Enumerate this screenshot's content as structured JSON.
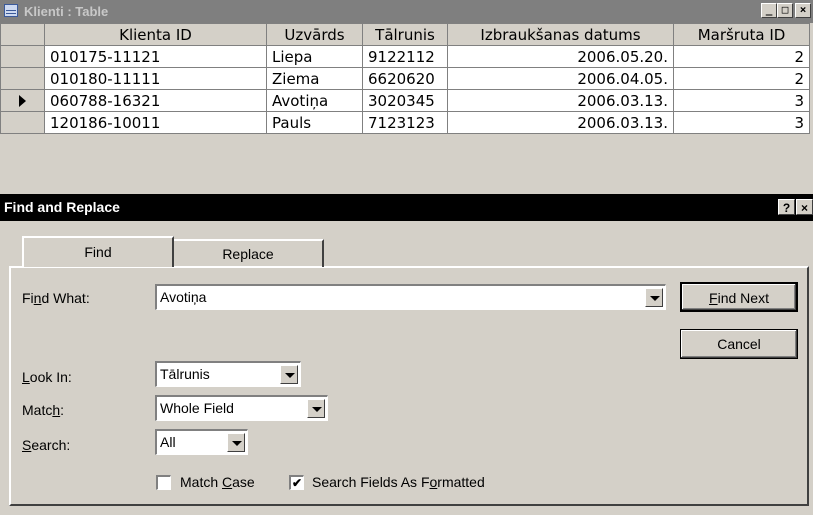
{
  "table_window": {
    "title": "Klienti : Table",
    "buttons": {
      "minimize": "_",
      "maximize": "□",
      "close": "×"
    },
    "columns": [
      "Klienta ID",
      "Uzvārds",
      "Tālrunis",
      "Izbraukšanas datums",
      "Maršruta ID"
    ],
    "rows": [
      {
        "selector": "",
        "cells": [
          "010175-11121",
          "Liepa",
          "9122112",
          "2006.05.20.",
          "2"
        ]
      },
      {
        "selector": "",
        "cells": [
          "010180-11111",
          "Ziema",
          "6620620",
          "2006.04.05.",
          "2"
        ]
      },
      {
        "selector": "current-record-arrow",
        "cells": [
          "060788-16321",
          "Avotiņa",
          "3020345",
          "2006.03.13.",
          "3"
        ]
      },
      {
        "selector": "",
        "cells": [
          "120186-10011",
          "Pauls",
          "7123123",
          "2006.03.13.",
          "3"
        ]
      }
    ]
  },
  "dialog": {
    "title": "Find and Replace",
    "help_button": "?",
    "close_button": "×",
    "tabs": [
      {
        "label": "Find",
        "active": true
      },
      {
        "label": "Replace",
        "active": false
      }
    ],
    "find_what": {
      "label_pre": "Fi",
      "label_key": "n",
      "label_post": "d What:",
      "value": "Avotiņa"
    },
    "look_in": {
      "label_pre": "",
      "label_key": "L",
      "label_post": "ook In:",
      "value": "Tālrunis"
    },
    "match": {
      "label_pre": "Matc",
      "label_key": "h",
      "label_post": ":",
      "value": "Whole Field"
    },
    "search": {
      "label_pre": "",
      "label_key": "S",
      "label_post": "earch:",
      "value": "All"
    },
    "match_case": {
      "label_pre": "Match ",
      "label_key": "C",
      "label_post": "ase",
      "checked": false
    },
    "search_formatted": {
      "label_pre": "Search Fields As F",
      "label_key": "o",
      "label_post": "rmatted",
      "checked": true,
      "check_glyph": "✔"
    },
    "find_next": {
      "label_key": "F",
      "label_post": "ind Next"
    },
    "cancel": "Cancel"
  }
}
